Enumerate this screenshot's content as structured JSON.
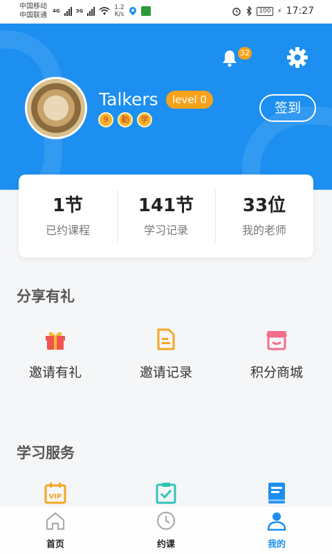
{
  "status_bar": {
    "carrier1": "中国移动",
    "carrier2": "中国联通",
    "net1": "4G",
    "net2": "3G",
    "speed": "1.2",
    "speed_unit": "K/s",
    "battery": "100",
    "time": "17:27"
  },
  "header": {
    "notification_count": "32",
    "username": "Talkers",
    "level": "level 0",
    "checkin_label": "签到",
    "medals": [
      "9",
      "勤",
      "学"
    ],
    "brand_color": "#1c8ff0",
    "badge_color": "#f7a21b"
  },
  "stats": [
    {
      "value": "1节",
      "label": "已约课程"
    },
    {
      "value": "141节",
      "label": "学习记录"
    },
    {
      "value": "33位",
      "label": "我的老师"
    }
  ],
  "share_section": {
    "title": "分享有礼",
    "items": [
      {
        "label": "邀请有礼",
        "icon": "gift-icon"
      },
      {
        "label": "邀请记录",
        "icon": "document-icon"
      },
      {
        "label": "积分商城",
        "icon": "store-icon"
      }
    ]
  },
  "study_section": {
    "title": "学习服务",
    "items": [
      {
        "icon": "vip-calendar-icon"
      },
      {
        "icon": "checklist-icon"
      },
      {
        "icon": "book-icon"
      }
    ]
  },
  "tabbar": {
    "tabs": [
      {
        "label": "首页",
        "icon": "home-icon"
      },
      {
        "label": "约课",
        "icon": "clock-icon"
      },
      {
        "label": "我的",
        "icon": "person-icon"
      }
    ],
    "active_index": 2
  }
}
